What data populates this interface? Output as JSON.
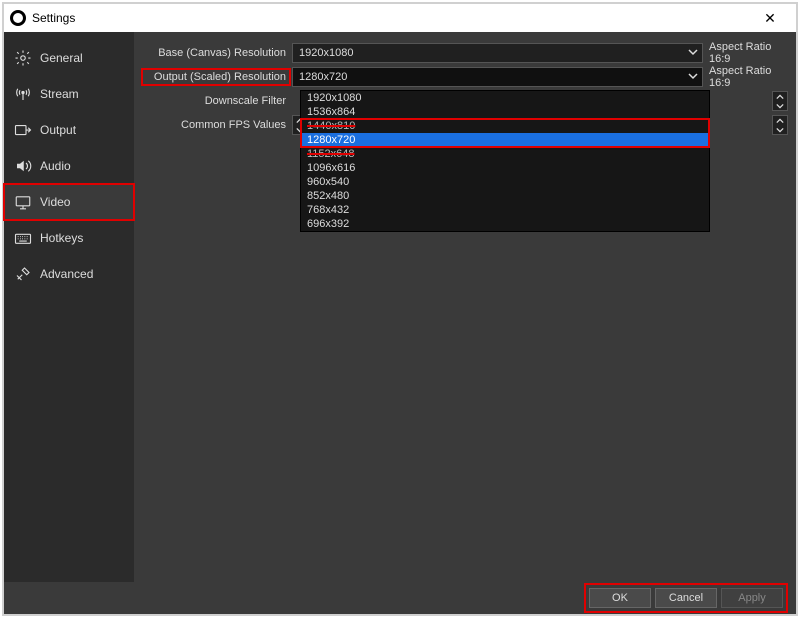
{
  "window": {
    "title": "Settings",
    "close_glyph": "✕"
  },
  "sidebar": {
    "items": [
      {
        "label": "General"
      },
      {
        "label": "Stream"
      },
      {
        "label": "Output"
      },
      {
        "label": "Audio"
      },
      {
        "label": "Video"
      },
      {
        "label": "Hotkeys"
      },
      {
        "label": "Advanced"
      }
    ]
  },
  "video": {
    "base_label": "Base (Canvas) Resolution",
    "base_value": "1920x1080",
    "base_aspect": "Aspect Ratio 16:9",
    "output_label": "Output (Scaled) Resolution",
    "output_value": "1280x720",
    "output_aspect": "Aspect Ratio 16:9",
    "downscale_label": "Downscale Filter",
    "fps_label": "Common FPS Values",
    "dropdown_options": [
      "1920x1080",
      "1536x864",
      "1440x810",
      "1280x720",
      "1152x648",
      "1096x616",
      "960x540",
      "852x480",
      "768x432",
      "696x392"
    ]
  },
  "footer": {
    "ok": "OK",
    "cancel": "Cancel",
    "apply": "Apply"
  }
}
